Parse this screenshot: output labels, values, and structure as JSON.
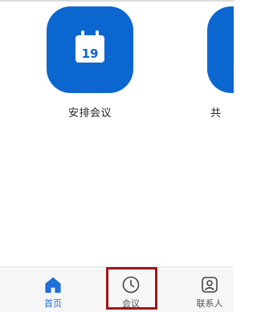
{
  "apps": [
    {
      "id": "schedule",
      "label": "安排会议",
      "icon": "calendar-icon",
      "date_number": "19"
    },
    {
      "id": "second",
      "label": "共",
      "icon": "app-icon"
    }
  ],
  "bottom_nav": {
    "items": [
      {
        "label": "首页",
        "icon": "home-icon",
        "active": true
      },
      {
        "label": "会议",
        "icon": "clock-icon",
        "active": false,
        "highlighted": true
      },
      {
        "label": "联系人",
        "icon": "contact-icon",
        "active": false
      }
    ]
  },
  "colors": {
    "brand_blue": "#0b66d0",
    "active_nav": "#1f6fd8",
    "highlight_red": "#a31515"
  }
}
